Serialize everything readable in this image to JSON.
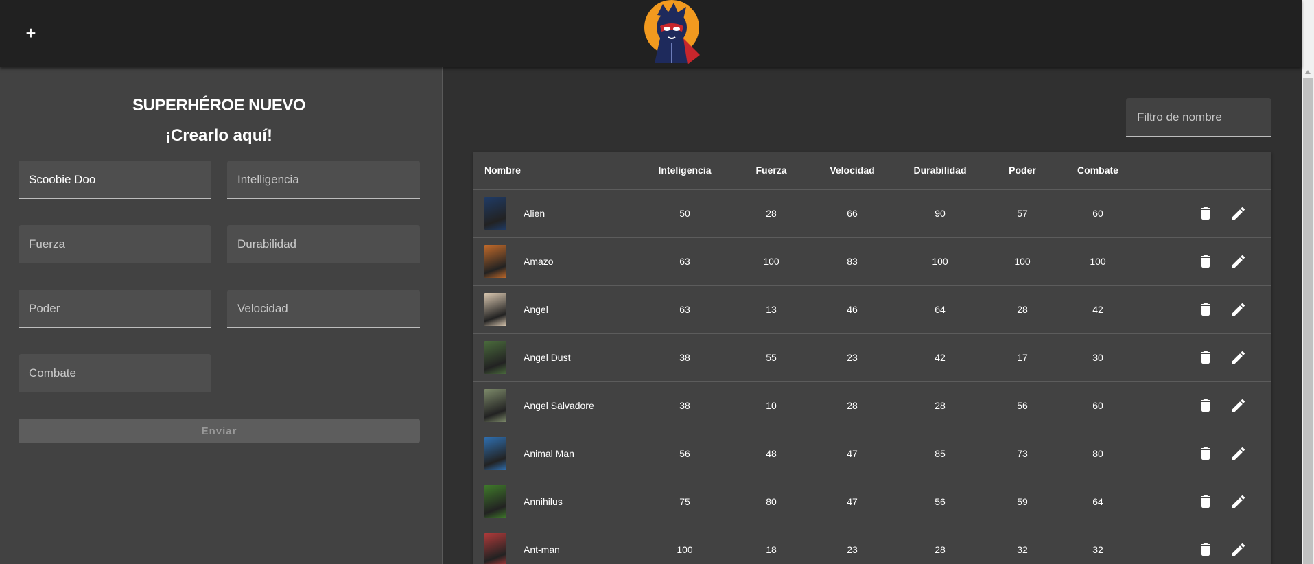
{
  "topbar": {
    "add_icon": "plus-icon",
    "add_label": "+",
    "logo_icon": "superhero-mascot-logo"
  },
  "form": {
    "title": "SUPERHÉROE NUEVO",
    "subtitle": "¡Crearlo aquí!",
    "fields": {
      "name": {
        "value": "Scoobie Doo",
        "placeholder": ""
      },
      "intelligence": {
        "value": "",
        "placeholder": "Intelligencia"
      },
      "strength": {
        "value": "",
        "placeholder": "Fuerza"
      },
      "durability": {
        "value": "",
        "placeholder": "Durabilidad"
      },
      "power": {
        "value": "",
        "placeholder": "Poder"
      },
      "speed": {
        "value": "",
        "placeholder": "Velocidad"
      },
      "combat": {
        "value": "",
        "placeholder": "Combate"
      }
    },
    "submit_label": "Enviar"
  },
  "filter": {
    "placeholder": "Filtro de nombre"
  },
  "table": {
    "columns": [
      "Nombre",
      "Inteligencia",
      "Fuerza",
      "Velocidad",
      "Durabilidad",
      "Poder",
      "Combate"
    ],
    "actions": {
      "delete_icon": "trash-icon",
      "edit_icon": "pencil-icon"
    },
    "rows": [
      {
        "name": "Alien",
        "thumb_color": "#1f3b66",
        "inteligencia": "50",
        "fuerza": "28",
        "velocidad": "66",
        "durabilidad": "90",
        "poder": "57",
        "combate": "60"
      },
      {
        "name": "Amazo",
        "thumb_color": "#c26a2a",
        "inteligencia": "63",
        "fuerza": "100",
        "velocidad": "83",
        "durabilidad": "100",
        "poder": "100",
        "combate": "100"
      },
      {
        "name": "Angel",
        "thumb_color": "#d9c7b0",
        "inteligencia": "63",
        "fuerza": "13",
        "velocidad": "46",
        "durabilidad": "64",
        "poder": "28",
        "combate": "42"
      },
      {
        "name": "Angel Dust",
        "thumb_color": "#4a6b3c",
        "inteligencia": "38",
        "fuerza": "55",
        "velocidad": "23",
        "durabilidad": "42",
        "poder": "17",
        "combate": "30"
      },
      {
        "name": "Angel Salvadore",
        "thumb_color": "#7d8a6a",
        "inteligencia": "38",
        "fuerza": "10",
        "velocidad": "28",
        "durabilidad": "28",
        "poder": "56",
        "combate": "60"
      },
      {
        "name": "Animal Man",
        "thumb_color": "#2f6fb0",
        "inteligencia": "56",
        "fuerza": "48",
        "velocidad": "47",
        "durabilidad": "85",
        "poder": "73",
        "combate": "80"
      },
      {
        "name": "Annihilus",
        "thumb_color": "#3f7a2a",
        "inteligencia": "75",
        "fuerza": "80",
        "velocidad": "47",
        "durabilidad": "56",
        "poder": "59",
        "combate": "64"
      },
      {
        "name": "Ant-man",
        "thumb_color": "#b03a3a",
        "inteligencia": "100",
        "fuerza": "18",
        "velocidad": "23",
        "durabilidad": "28",
        "poder": "32",
        "combate": "32"
      }
    ]
  }
}
